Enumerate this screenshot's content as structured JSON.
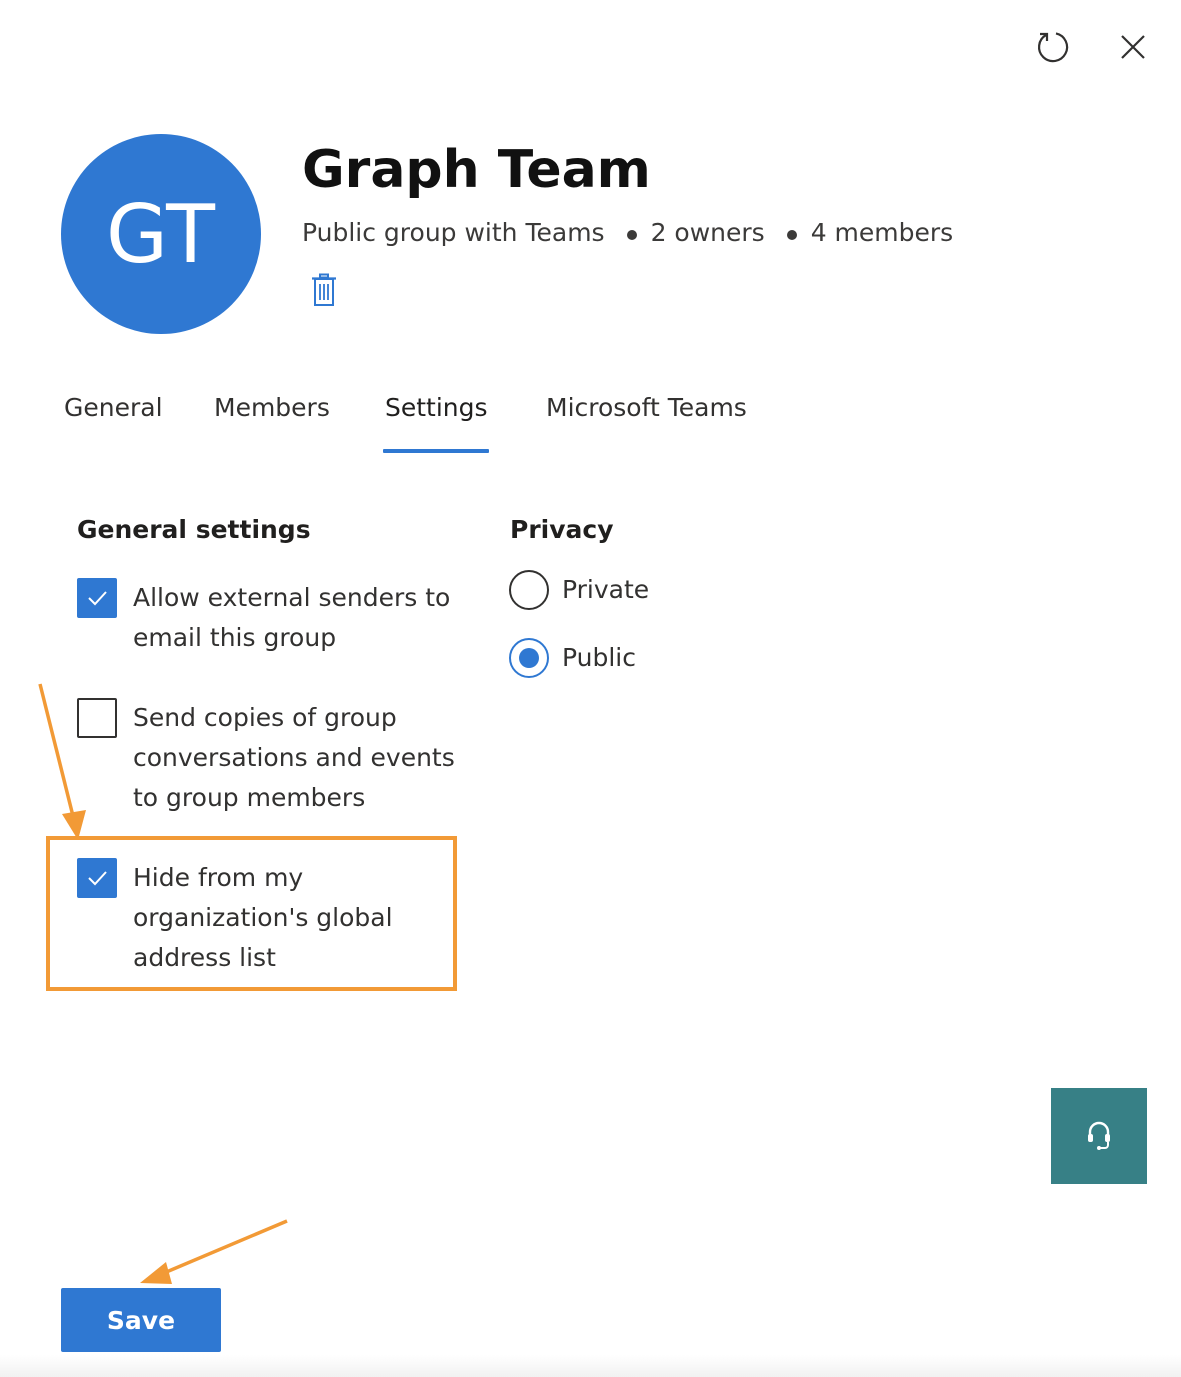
{
  "header": {
    "avatar_initials": "GT",
    "avatar_color": "#2f78d2",
    "title": "Graph Team",
    "group_type": "Public group with Teams",
    "owners": "2 owners",
    "members": "4 members",
    "icons": [
      "refresh-icon",
      "close-icon",
      "delete-icon"
    ]
  },
  "tabs": [
    {
      "label": "General",
      "selected": false
    },
    {
      "label": "Members",
      "selected": false
    },
    {
      "label": "Settings",
      "selected": true
    },
    {
      "label": "Microsoft Teams",
      "selected": false
    }
  ],
  "general_settings": {
    "heading": "General settings",
    "options": [
      {
        "label": "Allow external senders to email this group",
        "checked": true
      },
      {
        "label": "Send copies of group conversations and events to group members",
        "checked": false
      },
      {
        "label": "Hide from my organization's global address list",
        "checked": true
      }
    ]
  },
  "privacy": {
    "heading": "Privacy",
    "options": [
      {
        "label": "Private",
        "selected": false
      },
      {
        "label": "Public",
        "selected": true
      }
    ]
  },
  "footer": {
    "save_label": "Save"
  },
  "colors": {
    "accent": "#2f78d2",
    "annotation": "#f29a36",
    "support_button": "#378086"
  }
}
